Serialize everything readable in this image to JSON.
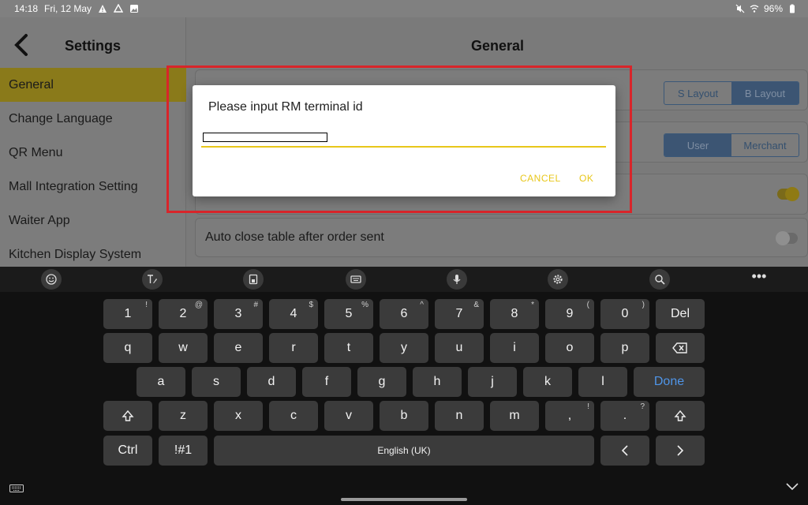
{
  "status_bar": {
    "time": "14:18",
    "date": "Fri, 12 May",
    "battery": "96%"
  },
  "sidebar": {
    "title": "Settings",
    "items": [
      {
        "label": "General",
        "active": true
      },
      {
        "label": "Change Language"
      },
      {
        "label": "QR Menu"
      },
      {
        "label": "Mall Integration Setting"
      },
      {
        "label": "Waiter App"
      },
      {
        "label": "Kitchen Display System"
      }
    ]
  },
  "main": {
    "title": "General",
    "layout_options": [
      "S Layout",
      "B Layout"
    ],
    "mode_options": [
      "User",
      "Merchant"
    ],
    "auto_close_label": "Auto close table after order sent"
  },
  "dialog": {
    "title": "Please input RM terminal id",
    "input_value": "",
    "cancel_label": "CANCEL",
    "ok_label": "OK"
  },
  "keyboard": {
    "row1": [
      {
        "k": "1",
        "h": "!"
      },
      {
        "k": "2",
        "h": "@"
      },
      {
        "k": "3",
        "h": "#"
      },
      {
        "k": "4",
        "h": "$"
      },
      {
        "k": "5",
        "h": "%"
      },
      {
        "k": "6",
        "h": "^"
      },
      {
        "k": "7",
        "h": "&"
      },
      {
        "k": "8",
        "h": "*"
      },
      {
        "k": "9",
        "h": "("
      },
      {
        "k": "0",
        "h": ")"
      },
      {
        "k": "Del",
        "h": ""
      }
    ],
    "row2": [
      "q",
      "w",
      "e",
      "r",
      "t",
      "y",
      "u",
      "i",
      "o",
      "p"
    ],
    "row3": [
      "a",
      "s",
      "d",
      "f",
      "g",
      "h",
      "j",
      "k",
      "l",
      "Done"
    ],
    "row4": [
      {
        "k": "z",
        "h": ""
      },
      {
        "k": "x",
        "h": ""
      },
      {
        "k": "c",
        "h": ""
      },
      {
        "k": "v",
        "h": ""
      },
      {
        "k": "b",
        "h": ""
      },
      {
        "k": "n",
        "h": ""
      },
      {
        "k": "m",
        "h": ""
      },
      {
        "k": ",",
        "h": "!"
      },
      {
        "k": ".",
        "h": "?"
      }
    ],
    "ctrl": "Ctrl",
    "symbols": "!#1",
    "space": "English (UK)"
  },
  "colors": {
    "accent": "#e8c71a",
    "highlight": "#d8252a",
    "done": "#4f95e8"
  }
}
